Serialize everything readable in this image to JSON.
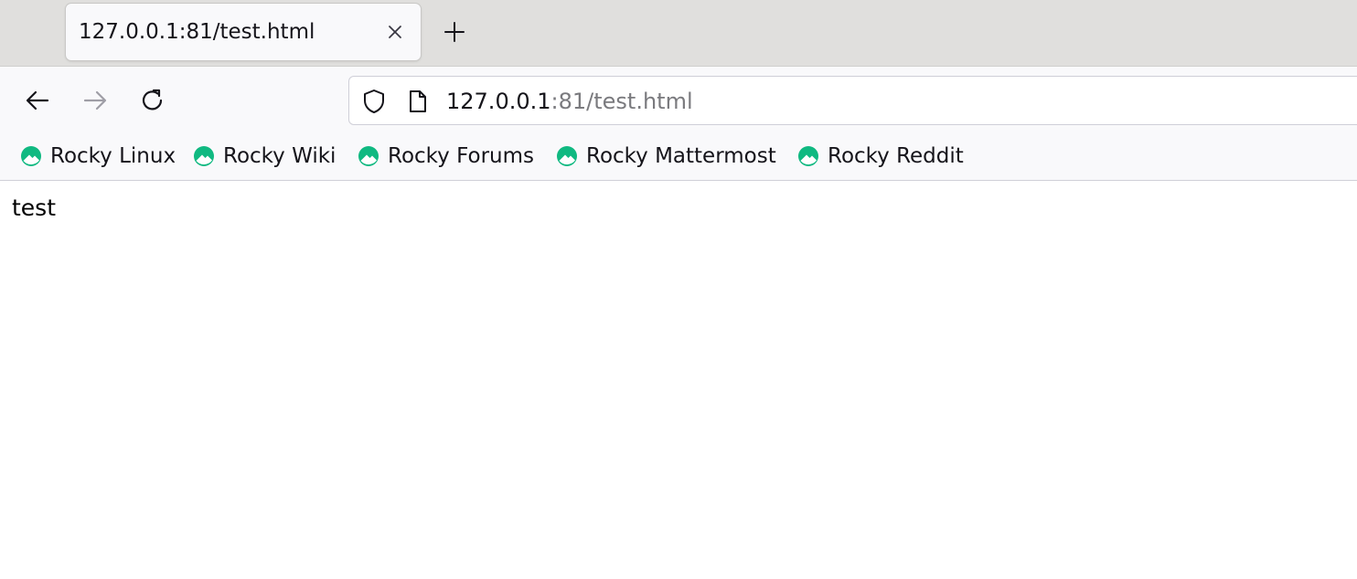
{
  "tabs": [
    {
      "title": "127.0.0.1:81/test.html",
      "active": true
    }
  ],
  "toolbar": {
    "back_icon": "arrow-left-icon",
    "forward_icon": "arrow-right-icon",
    "reload_icon": "reload-icon",
    "new_tab_icon": "plus-icon",
    "close_tab_icon": "close-icon"
  },
  "urlbar": {
    "host": "127.0.0.1",
    "rest": ":81/test.html",
    "security_icon": "shield-icon",
    "page_icon": "page-icon"
  },
  "bookmarks": [
    {
      "label": "Rocky Linux",
      "icon": "rocky-logo-icon"
    },
    {
      "label": "Rocky Wiki",
      "icon": "rocky-logo-icon"
    },
    {
      "label": "Rocky Forums",
      "icon": "rocky-logo-icon"
    },
    {
      "label": "Rocky Mattermost",
      "icon": "rocky-logo-icon"
    },
    {
      "label": "Rocky Reddit",
      "icon": "rocky-logo-icon"
    }
  ],
  "page": {
    "body_text": "test"
  },
  "colors": {
    "tabstrip_bg": "#e0dfdd",
    "toolbar_bg": "#f9f9fb",
    "rocky_green": "#10b981"
  }
}
